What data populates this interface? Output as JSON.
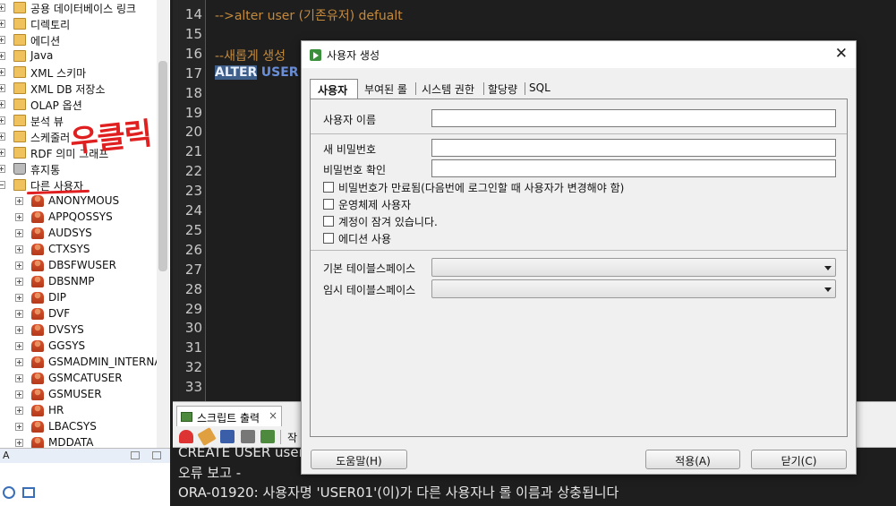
{
  "tree": {
    "items": [
      {
        "label": "공용 데이터베이스 링크",
        "type": "folder"
      },
      {
        "label": "디렉토리",
        "type": "folder"
      },
      {
        "label": "에디션",
        "type": "folder"
      },
      {
        "label": "Java",
        "type": "folder"
      },
      {
        "label": "XML 스키마",
        "type": "folder"
      },
      {
        "label": "XML DB 저장소",
        "type": "folder"
      },
      {
        "label": "OLAP 옵션",
        "type": "folder"
      },
      {
        "label": "분석 뷰",
        "type": "folder"
      },
      {
        "label": "스케줄러",
        "type": "folder"
      },
      {
        "label": "RDF 의미 그래프",
        "type": "folder"
      },
      {
        "label": "휴지통",
        "type": "trash"
      },
      {
        "label": "다른 사용자",
        "type": "folder"
      }
    ],
    "users": [
      "ANONYMOUS",
      "APPQOSSYS",
      "AUDSYS",
      "CTXSYS",
      "DBSFWUSER",
      "DBSNMP",
      "DIP",
      "DVF",
      "DVSYS",
      "GGSYS",
      "GSMADMIN_INTERNAL",
      "GSMCATUSER",
      "GSMUSER",
      "HR",
      "LBACSYS",
      "MDDATA"
    ],
    "bottom_label": "A"
  },
  "annotation": {
    "text": "우클릭",
    "color": "#e02020"
  },
  "editor": {
    "line_numbers": [
      "14",
      "15",
      "16",
      "17",
      "18",
      "19",
      "20",
      "21",
      "22",
      "23",
      "24",
      "25",
      "26",
      "27",
      "28",
      "29",
      "30",
      "31",
      "32",
      "33"
    ],
    "line14": "-->alter user (기존유저) defualt",
    "line16": "--새롭게 생성",
    "line17_kw1": "ALTER",
    "line17_kw2": "USER"
  },
  "output": {
    "tab_label": "스크립트 출력",
    "tab_close": "×",
    "toolbar_trailing": "작",
    "lines": [
      "CREATE USER user",
      "오류 보고 -",
      "ORA-01920: 사용자명 'USER01'(이)가 다른 사용자나 롤 이름과 상충됩니다"
    ]
  },
  "dialog": {
    "title": "사용자 생성",
    "close": "✕",
    "tabs": [
      "사용자",
      "부여된 롤",
      "시스템 권한",
      "할당량",
      "SQL"
    ],
    "fields": {
      "username_label": "사용자 이름",
      "username_value": "",
      "new_password_label": "새 비밀번호",
      "confirm_password_label": "비밀번호 확인"
    },
    "checkboxes": [
      {
        "label": "비밀번호가 만료됨(다음번에 로그인할 때 사용자가 변경해야 함)",
        "checked": false
      },
      {
        "label": "운영체제 사용자",
        "checked": false
      },
      {
        "label": "계정이 잠겨 있습니다.",
        "checked": false
      },
      {
        "label": "에디션 사용",
        "checked": false
      }
    ],
    "default_tablespace_label": "기본 테이블스페이스",
    "default_tablespace_value": "",
    "temp_tablespace_label": "임시 테이블스페이스",
    "temp_tablespace_value": "",
    "buttons": {
      "help": "도움말(H)",
      "apply": "적용(A)",
      "close": "닫기(C)"
    }
  }
}
